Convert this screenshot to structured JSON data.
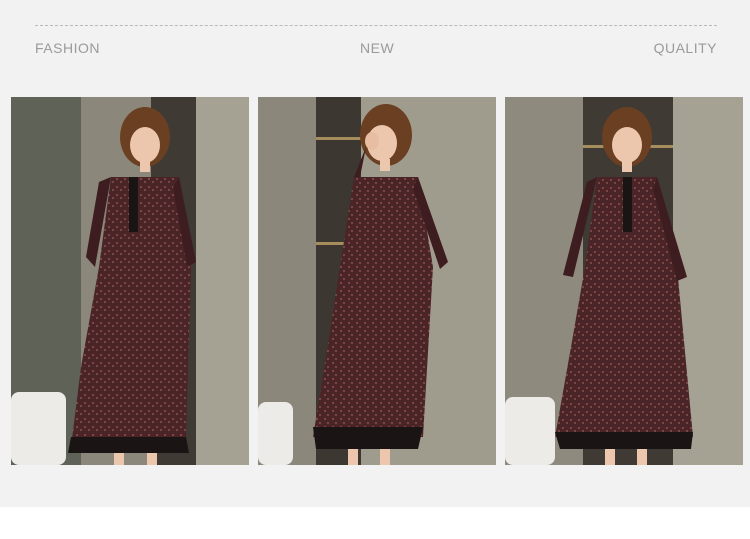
{
  "banner": {
    "labels": {
      "left": "FASHION",
      "center": "NEW",
      "right": "QUALITY"
    }
  },
  "photos": [
    {
      "alt": "Model in floral long-sleeve dress, front view"
    },
    {
      "alt": "Model in floral long-sleeve dress, hand raised to face"
    },
    {
      "alt": "Model in floral long-sleeve dress, smiling front view"
    }
  ],
  "colors": {
    "dress": "#4a2528",
    "background": "#f2f2f2",
    "label": "#9a9a9a"
  }
}
